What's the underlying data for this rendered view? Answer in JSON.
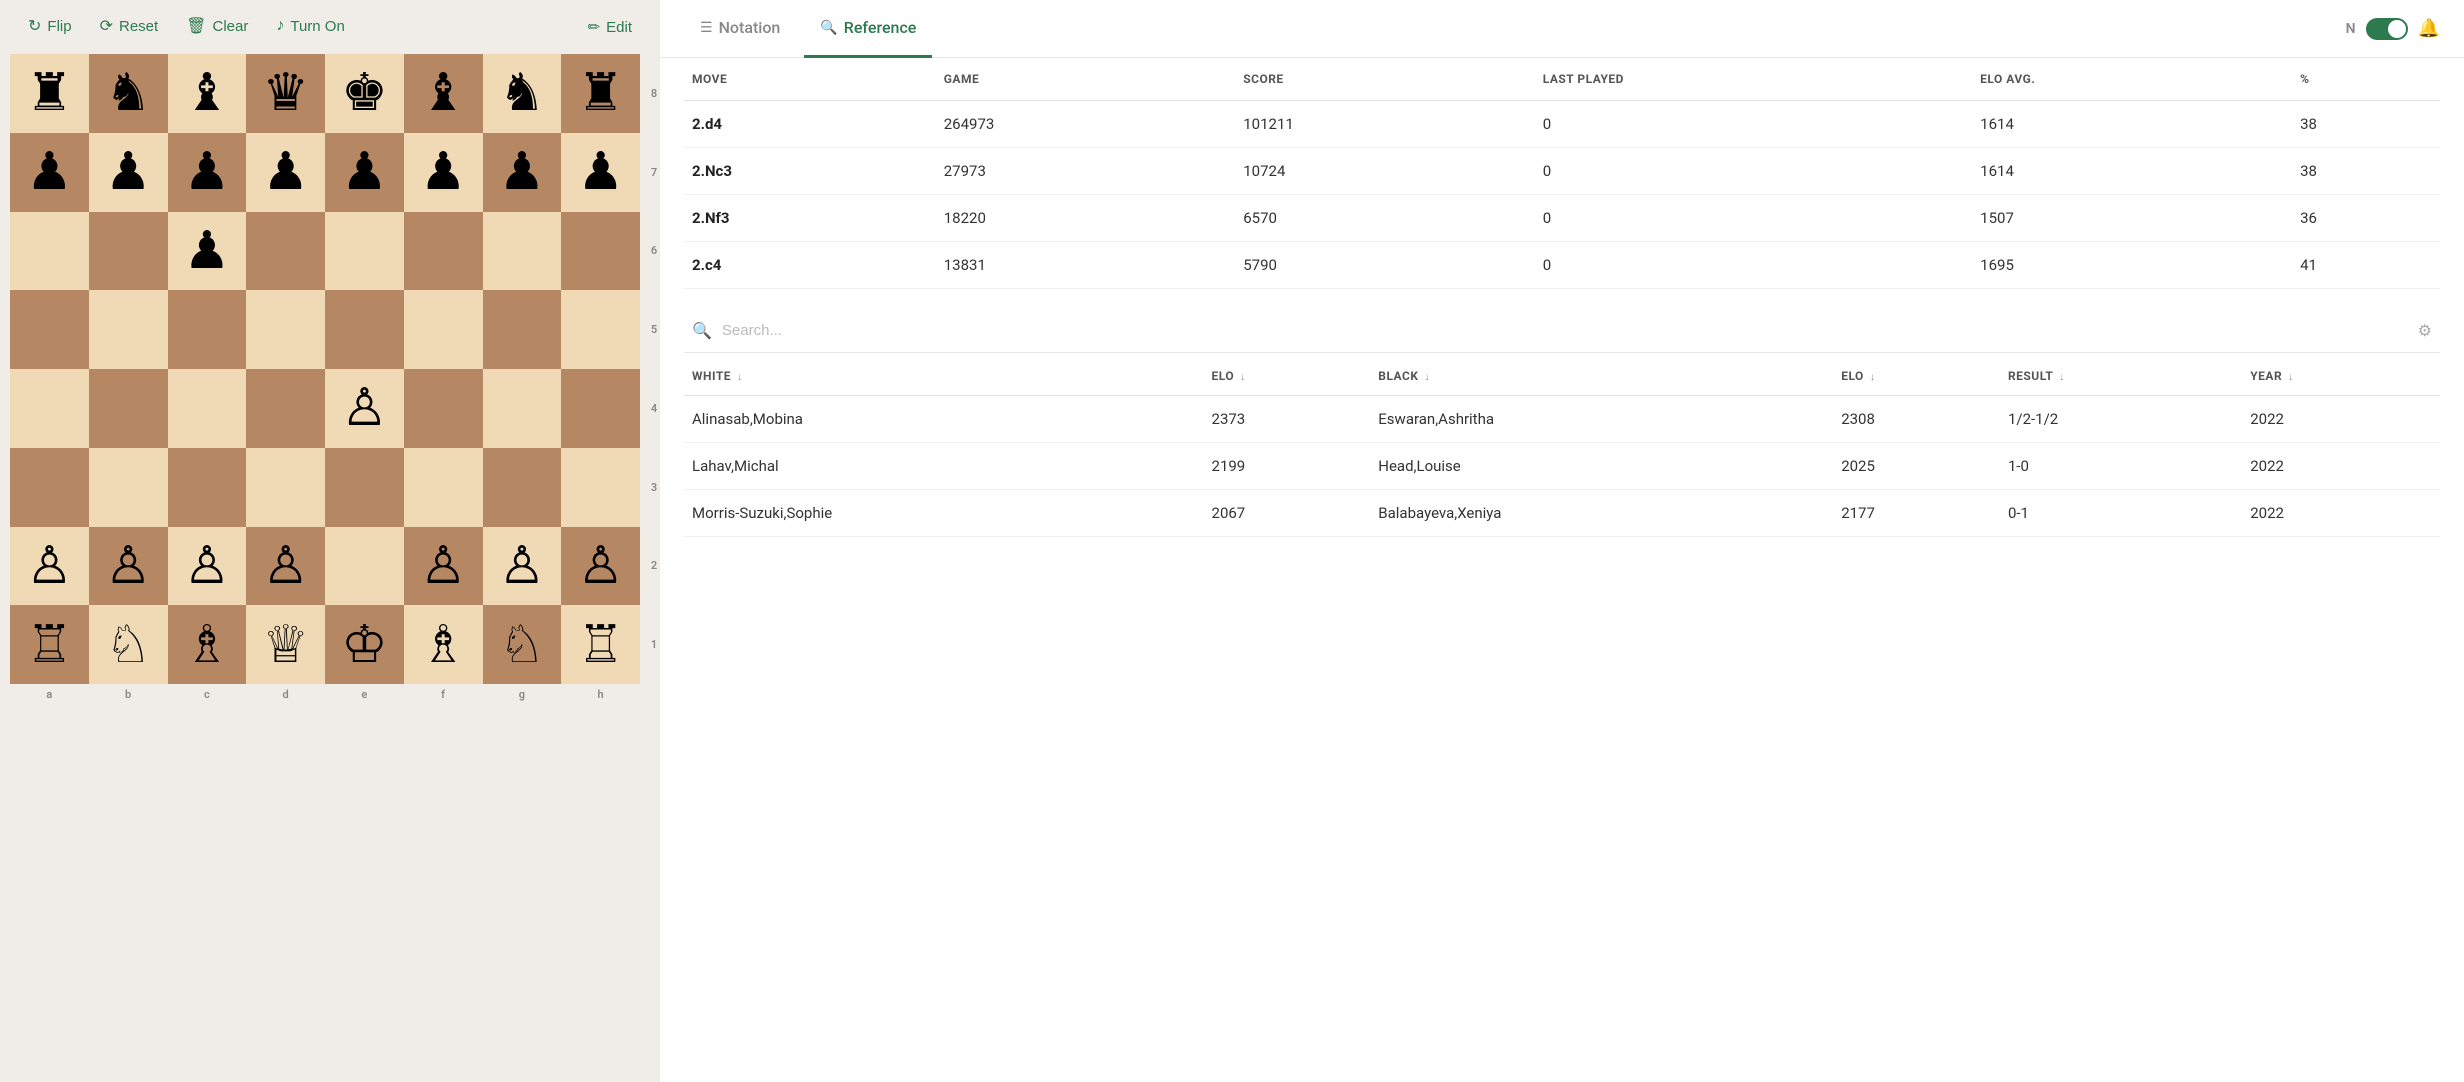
{
  "toolbar": {
    "flip_label": "Flip",
    "reset_label": "Reset",
    "clear_label": "Clear",
    "turn_on_label": "Turn On",
    "edit_label": "Edit"
  },
  "tabs": {
    "notation_label": "Notation",
    "reference_label": "Reference",
    "active": "reference"
  },
  "tab_controls": {
    "toggle_label": "N"
  },
  "moves_table": {
    "headers": [
      "MOVE",
      "GAME",
      "SCORE",
      "LAST PLAYED",
      "ELO AVG.",
      "%"
    ],
    "rows": [
      {
        "move": "2.d4",
        "game": "264973",
        "score": "101211",
        "last_played": "0",
        "elo_avg": "1614",
        "pct": "38"
      },
      {
        "move": "2.Nc3",
        "game": "27973",
        "score": "10724",
        "last_played": "0",
        "elo_avg": "1614",
        "pct": "38"
      },
      {
        "move": "2.Nf3",
        "game": "18220",
        "score": "6570",
        "last_played": "0",
        "elo_avg": "1507",
        "pct": "36"
      },
      {
        "move": "2.c4",
        "game": "13831",
        "score": "5790",
        "last_played": "0",
        "elo_avg": "1695",
        "pct": "41"
      }
    ]
  },
  "search": {
    "placeholder": "Search..."
  },
  "games_table": {
    "headers": [
      "WHITE",
      "ELO",
      "BLACK",
      "ELO",
      "RESULT",
      "YEAR"
    ],
    "rows": [
      {
        "white": "Alinasab,Mobina",
        "white_elo": "2373",
        "black": "Eswaran,Ashritha",
        "black_elo": "2308",
        "result": "1/2-1/2",
        "year": "2022"
      },
      {
        "white": "Lahav,Michal",
        "white_elo": "2199",
        "black": "Head,Louise",
        "black_elo": "2025",
        "result": "1-0",
        "year": "2022"
      },
      {
        "white": "Morris-Suzuki,Sophie",
        "white_elo": "2067",
        "black": "Balabayeva,Xeniya",
        "black_elo": "2177",
        "result": "0-1",
        "year": "2022"
      }
    ]
  },
  "board": {
    "ranks": [
      "8",
      "7",
      "6",
      "5",
      "4",
      "3",
      "2",
      "1"
    ],
    "files": [
      "a",
      "b",
      "c",
      "d",
      "e",
      "f",
      "g",
      "h"
    ],
    "squares": [
      [
        "♜",
        "♞",
        "♝",
        "♛",
        "♚",
        "♝",
        "♞",
        "♜"
      ],
      [
        "♟",
        "♟",
        "♟",
        "♟",
        "♟",
        "♟",
        "♟",
        "♟"
      ],
      [
        " ",
        " ",
        "♟",
        " ",
        " ",
        " ",
        " ",
        " "
      ],
      [
        " ",
        " ",
        " ",
        " ",
        " ",
        " ",
        " ",
        " "
      ],
      [
        " ",
        " ",
        " ",
        " ",
        "♙",
        " ",
        " ",
        " "
      ],
      [
        " ",
        " ",
        " ",
        " ",
        " ",
        " ",
        " ",
        " "
      ],
      [
        "♙",
        "♙",
        "♙",
        "♙",
        " ",
        "♙",
        "♙",
        "♙"
      ],
      [
        "♖",
        "♘",
        "♗",
        "♕",
        "♔",
        "♗",
        "♘",
        "♖"
      ]
    ]
  }
}
